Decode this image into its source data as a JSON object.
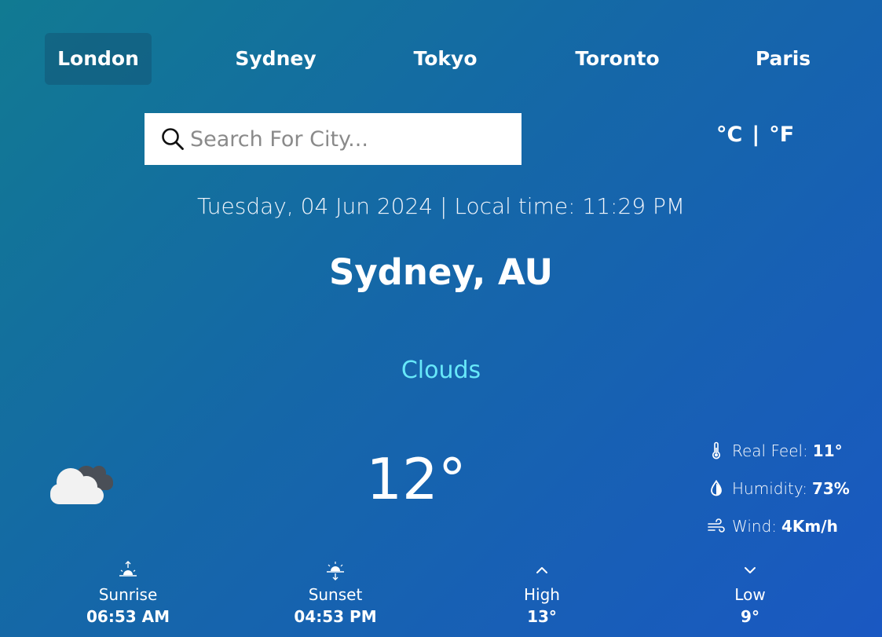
{
  "cities": [
    {
      "label": "London",
      "active": true
    },
    {
      "label": "Sydney",
      "active": false
    },
    {
      "label": "Tokyo",
      "active": false
    },
    {
      "label": "Toronto",
      "active": false
    },
    {
      "label": "Paris",
      "active": false
    }
  ],
  "search": {
    "placeholder": "Search For City...",
    "value": ""
  },
  "units": {
    "celsius": "°C",
    "separator": "|",
    "fahrenheit": "°F"
  },
  "datetime": "Tuesday, 04 Jun 2024 | Local time: 11:29 PM",
  "location": "Sydney, AU",
  "condition": "Clouds",
  "temperature": "12°",
  "details": {
    "real_feel_label": "Real Feel:",
    "real_feel_value": "11°",
    "humidity_label": "Humidity:",
    "humidity_value": "73%",
    "wind_label": "Wind:",
    "wind_value": "4Km/h"
  },
  "stats": {
    "sunrise_label": "Sunrise",
    "sunrise_value": "06:53 AM",
    "sunset_label": "Sunset",
    "sunset_value": "04:53 PM",
    "high_label": "High",
    "high_value": "13°",
    "low_label": "Low",
    "low_value": "9°"
  },
  "colors": {
    "condition": "#67e8f9",
    "background_start": "#117a92",
    "background_end": "#1a58c2"
  },
  "icons": {
    "weather": "clouds-icon",
    "search": "search-icon",
    "real_feel": "thermometer-icon",
    "humidity": "droplet-icon",
    "wind": "wind-icon",
    "sunrise": "sunrise-icon",
    "sunset": "sunset-icon",
    "high": "chevron-up-icon",
    "low": "chevron-down-icon"
  }
}
